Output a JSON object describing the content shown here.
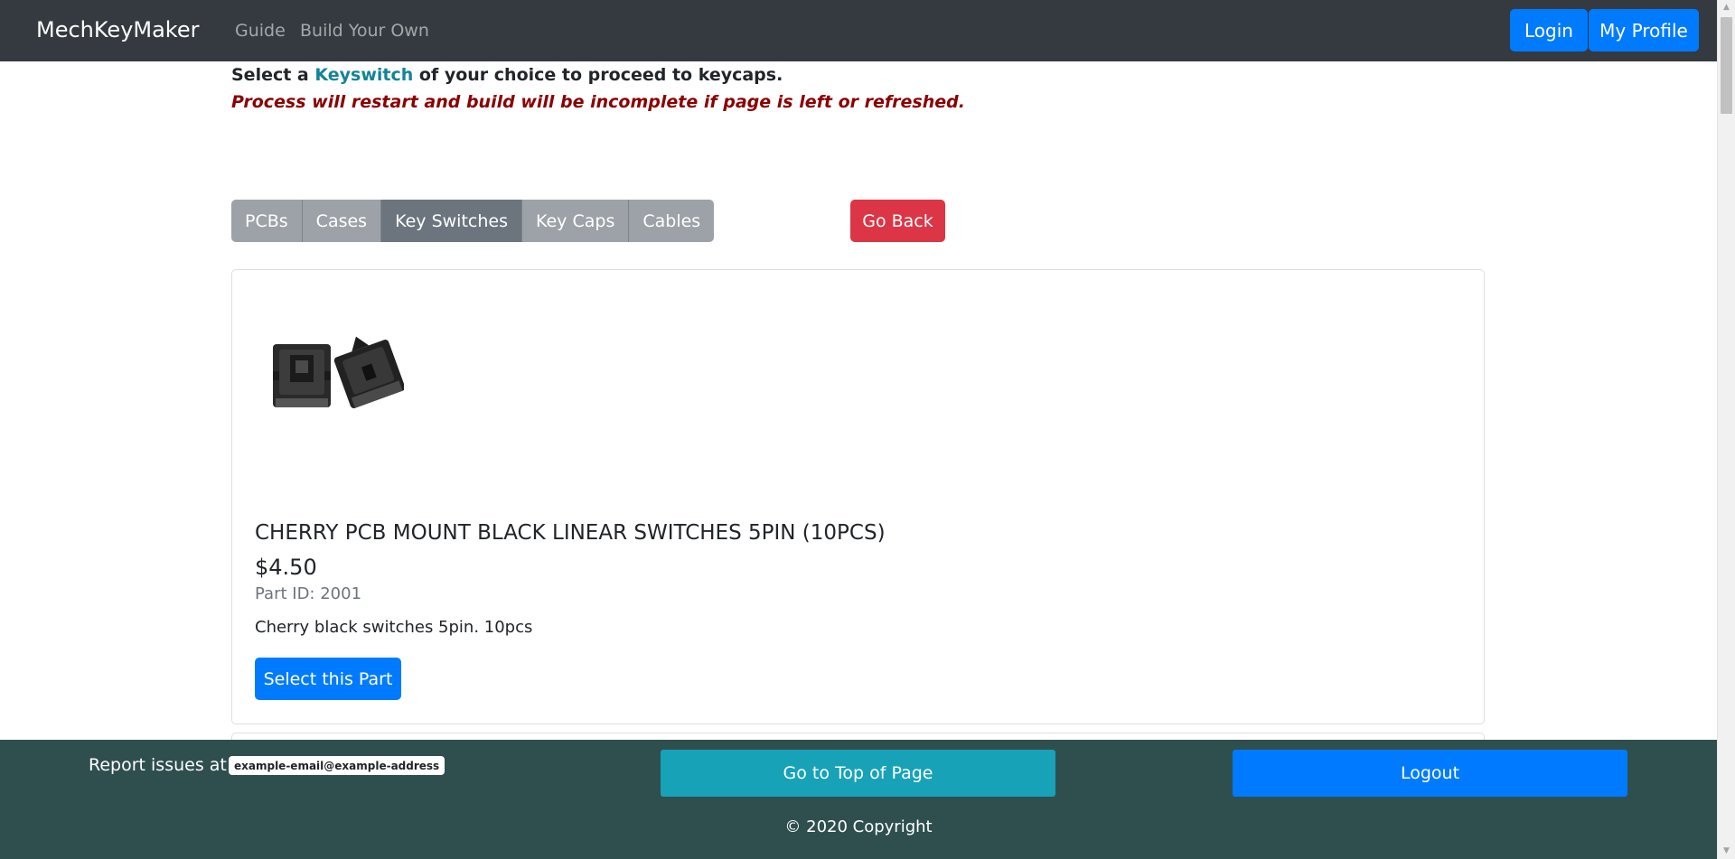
{
  "navbar": {
    "brand": "MechKeyMaker",
    "links": [
      "Guide",
      "Build Your Own"
    ],
    "login_label": "Login",
    "profile_label": "My Profile"
  },
  "instructions": {
    "prefix": "Select a ",
    "accent": "Keyswitch",
    "suffix": " of your choice to proceed to keycaps.",
    "accent_color": "#138496",
    "warning": "Process will restart and build will be incomplete if page is left or refreshed.",
    "warning_color": "#8b0000"
  },
  "tabs": [
    {
      "label": "PCBs",
      "active": false
    },
    {
      "label": "Cases",
      "active": false
    },
    {
      "label": "Key Switches",
      "active": true
    },
    {
      "label": "Key Caps",
      "active": false
    },
    {
      "label": "Cables",
      "active": false
    }
  ],
  "go_back_label": "Go Back",
  "product": {
    "image_icon": "keyswitch-image",
    "title": "CHERRY PCB MOUNT BLACK LINEAR SWITCHES 5PIN (10PCS)",
    "price": "$4.50",
    "part_id": "Part ID: 2001",
    "description": "Cherry black switches 5pin. 10pcs",
    "select_label": "Select this Part"
  },
  "footer": {
    "report_text": "Report issues at",
    "email": "example-email@example-address",
    "top_label": "Go to Top of Page",
    "logout_label": "Logout",
    "copyright": "© 2020 Copyright"
  },
  "colors": {
    "navbar": "#343a40",
    "primary": "#007bff",
    "danger": "#dc3545",
    "info": "#17a2b8",
    "footer": "#2f4f4f",
    "tab": "#9da2a8",
    "tab_active": "#6c757d"
  }
}
